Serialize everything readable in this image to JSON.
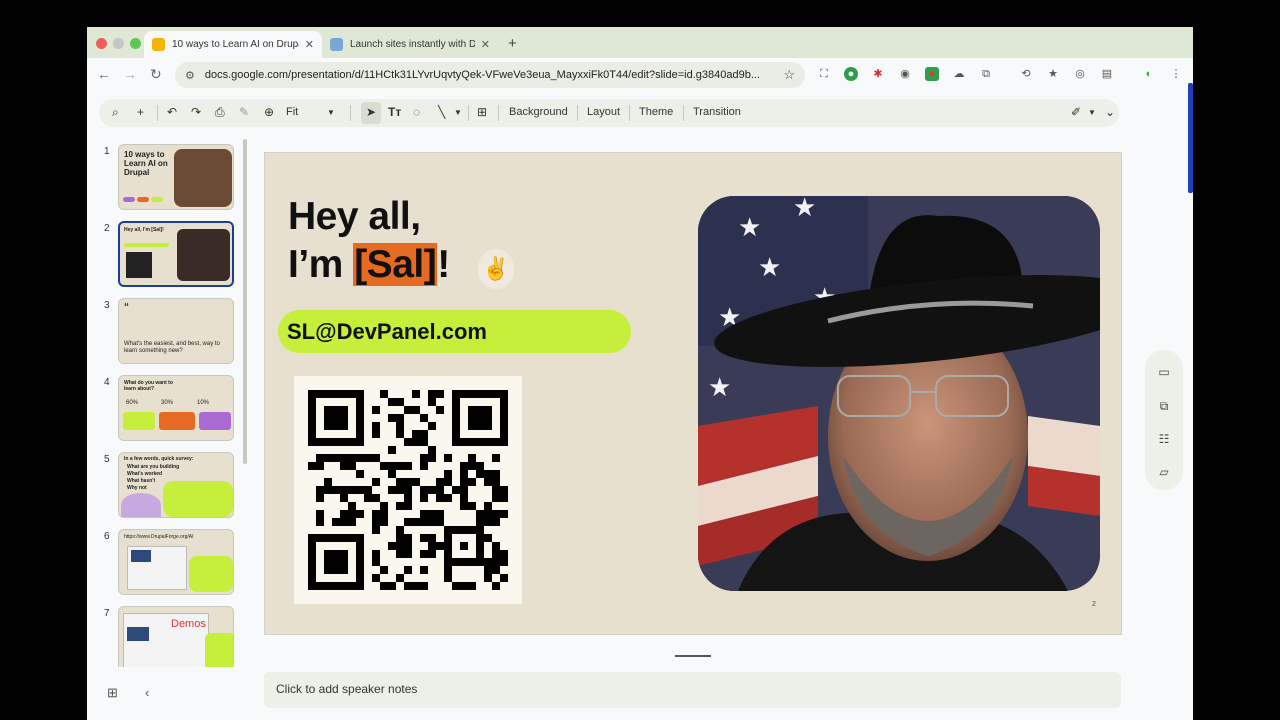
{
  "browser": {
    "tabs": [
      {
        "title": "10 ways to Learn AI on Drupal",
        "active": true
      },
      {
        "title": "Launch sites instantly with DevPanel",
        "active": false
      }
    ],
    "url": "docs.google.com/presentation/d/11HCtk31LYvrUqvtyQek-VFweVe3eua_MayxxiFk0T44/edit?slide=id.g3840ad9b..."
  },
  "toolbar": {
    "zoom": "Fit",
    "background_label": "Background",
    "layout_label": "Layout",
    "theme_label": "Theme",
    "transition_label": "Transition"
  },
  "filmstrip": [
    {
      "num": "1",
      "text": "10 ways to Learn AI on Drupal"
    },
    {
      "num": "2",
      "text": "Hey all, I'm [Sal]!"
    },
    {
      "num": "3",
      "text": "What's the easiest, and best, way to learn something new?"
    },
    {
      "num": "4",
      "text": "What do you want to learn about?"
    },
    {
      "num": "5",
      "text": "In a few words, quick survey:"
    },
    {
      "num": "6",
      "text": "https://www.DrupalForge.org/AI"
    },
    {
      "num": "7",
      "text": "Demos"
    }
  ],
  "thumbs": {
    "t3_quote": "“",
    "t4_pcts": [
      "60%",
      "30%",
      "10%"
    ],
    "t5_items": [
      "What are you building",
      "What's worked",
      "What hasn't",
      "Why not"
    ]
  },
  "slide": {
    "line1": "Hey all,",
    "line2_prefix": "I’m ",
    "name": "[Sal]",
    "line2_suffix": "!",
    "peace_emoji": "✌",
    "email": "SL@DevPanel.com",
    "page_number": "2"
  },
  "notes_placeholder": "Click to add speaker notes",
  "colors": {
    "accent_orange": "#e66a22",
    "accent_lime": "#c5ef3a",
    "slide_bg": "#e8e0cf",
    "selection_blue": "#1a3f94"
  }
}
